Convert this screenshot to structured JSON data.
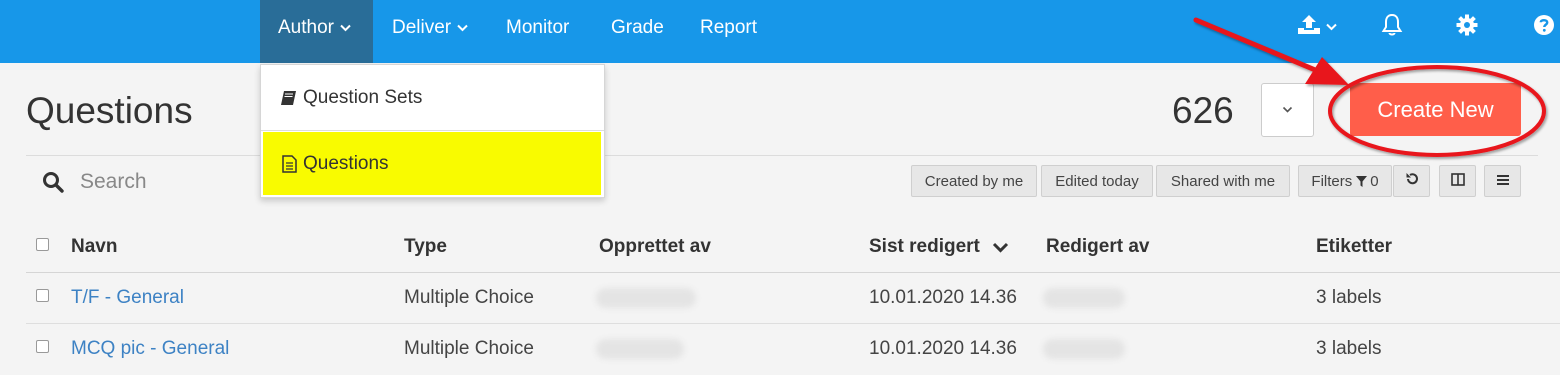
{
  "nav": {
    "author": "Author",
    "deliver": "Deliver",
    "monitor": "Monitor",
    "grade": "Grade",
    "report": "Report"
  },
  "icons": {
    "upload": "upload-icon",
    "bell": "bell-icon",
    "gear": "gear-icon",
    "help": "help-icon"
  },
  "dropdown": {
    "question_sets": "Question Sets",
    "questions": "Questions"
  },
  "page": {
    "title": "Questions",
    "count": "626",
    "create_new": "Create New"
  },
  "search": {
    "placeholder": "Search"
  },
  "filters": {
    "created_by_me": "Created by me",
    "edited_today": "Edited today",
    "shared_with_me": "Shared with me",
    "filters_label": "Filters",
    "filters_count": "0"
  },
  "table": {
    "headers": {
      "name": "Navn",
      "type": "Type",
      "created_by": "Opprettet av",
      "last_edited": "Sist redigert",
      "edited_by": "Redigert av",
      "labels": "Etiketter"
    },
    "rows": [
      {
        "name": "T/F - General",
        "type": "Multiple Choice",
        "last_edited": "10.01.2020 14.36",
        "labels": "3 labels"
      },
      {
        "name": "MCQ pic - General",
        "type": "Multiple Choice",
        "last_edited": "10.01.2020 14.36",
        "labels": "3 labels"
      }
    ]
  },
  "colors": {
    "nav_bg": "#1797e9",
    "nav_active": "#296d98",
    "create_btn": "#ff5e4a",
    "highlight": "#f9fb00",
    "annotation": "#e8141c",
    "link": "#3d82c4"
  }
}
